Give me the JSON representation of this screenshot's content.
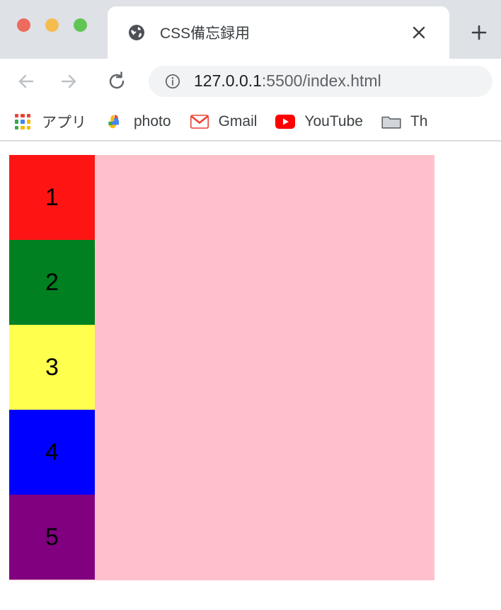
{
  "window": {
    "traffic_lights": [
      {
        "name": "close",
        "color": "#ed6a5e"
      },
      {
        "name": "minimize",
        "color": "#f5bd4f"
      },
      {
        "name": "maximize",
        "color": "#61c554"
      }
    ]
  },
  "tab": {
    "title": "CSS備忘録用",
    "favicon": "globe-icon",
    "close_label": "✕",
    "newtab_label": "＋"
  },
  "toolbar": {
    "back_label": "←",
    "forward_label": "→",
    "reload_label": "⟳",
    "omnibox": {
      "icon": "info-icon",
      "host": "127.0.0.1",
      "path": ":5500/index.html",
      "full_url": "127.0.0.1:5500/index.html"
    }
  },
  "bookmarks": [
    {
      "label": "アプリ",
      "icon": "apps-grid-icon"
    },
    {
      "label": "photo",
      "icon": "google-photos-icon"
    },
    {
      "label": "Gmail",
      "icon": "gmail-icon"
    },
    {
      "label": "YouTube",
      "icon": "youtube-icon"
    },
    {
      "label": "Th",
      "icon": "folder-icon"
    }
  ],
  "page": {
    "container_color": "#ffc0cb",
    "items": [
      {
        "label": "1",
        "color": "#ff1414"
      },
      {
        "label": "2",
        "color": "#008020"
      },
      {
        "label": "3",
        "color": "#ffff4d"
      },
      {
        "label": "4",
        "color": "#0000ff"
      },
      {
        "label": "5",
        "color": "#800080"
      }
    ]
  }
}
